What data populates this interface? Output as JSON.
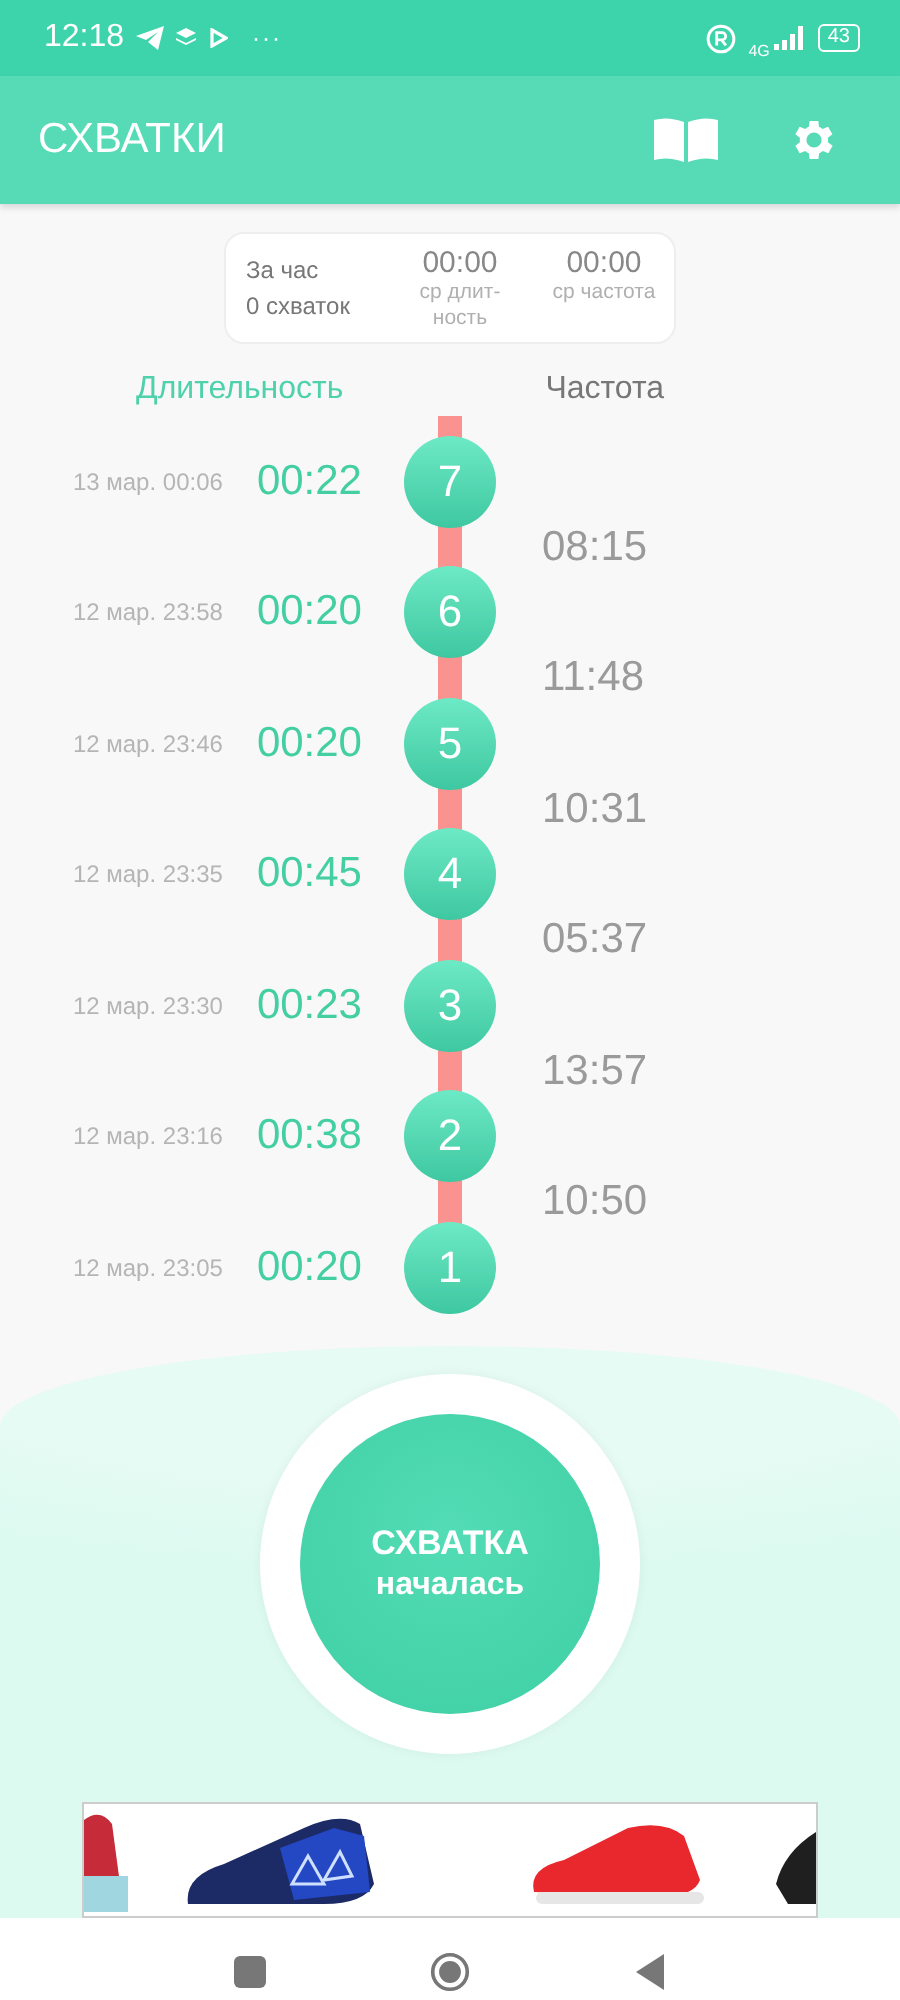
{
  "status_bar": {
    "time": "12:18",
    "more": "···",
    "network": "4G",
    "battery": "43"
  },
  "app_bar": {
    "title": "СХВАТКИ"
  },
  "summary": {
    "period_label": "За час",
    "count": "0 схваток",
    "stats": [
      {
        "value": "00:00",
        "label": "ср длит-ность"
      },
      {
        "value": "00:00",
        "label": "ср частота"
      }
    ]
  },
  "columns": {
    "duration": "Длительность",
    "frequency": "Частота"
  },
  "contractions": [
    {
      "date": "13 мар. 00:06",
      "duration": "00:22",
      "number": "7"
    },
    {
      "date": "12 мар. 23:58",
      "duration": "00:20",
      "number": "6"
    },
    {
      "date": "12 мар. 23:46",
      "duration": "00:20",
      "number": "5"
    },
    {
      "date": "12 мар. 23:35",
      "duration": "00:45",
      "number": "4"
    },
    {
      "date": "12 мар. 23:30",
      "duration": "00:23",
      "number": "3"
    },
    {
      "date": "12 мар. 23:16",
      "duration": "00:38",
      "number": "2"
    },
    {
      "date": "12 мар. 23:05",
      "duration": "00:20",
      "number": "1"
    }
  ],
  "frequencies": [
    "08:15",
    "11:48",
    "10:31",
    "05:37",
    "13:57",
    "10:50"
  ],
  "start_button": {
    "line1": "СХВАТКА",
    "line2": "началась"
  },
  "ad": {
    "kind": "picture"
  }
}
